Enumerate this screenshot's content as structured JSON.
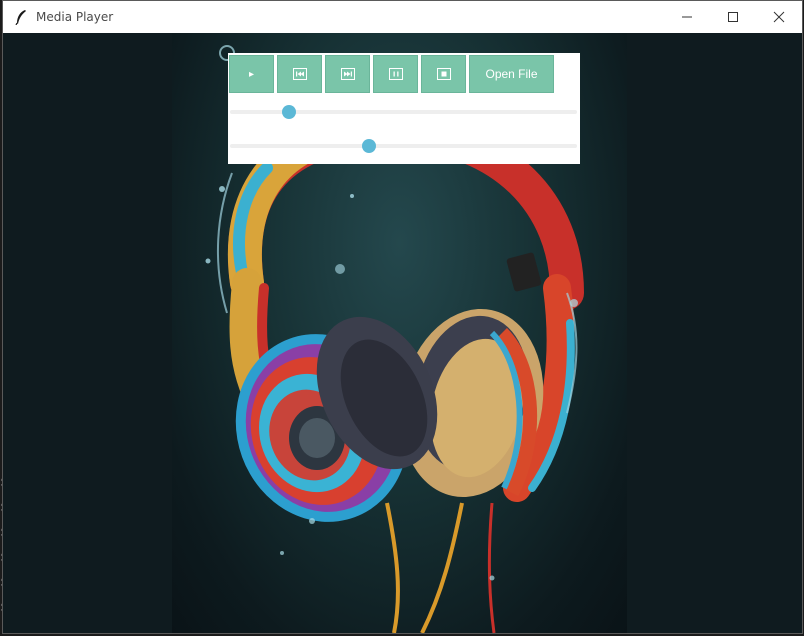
{
  "window": {
    "title": "Media Player"
  },
  "controls": {
    "play_label": "▸",
    "prev_label": "⏮",
    "next_label": "⏭",
    "pause_label": "⏸",
    "stop_label": "⏹",
    "open_file_label": "Open File"
  },
  "sliders": {
    "progress_fraction": 0.17,
    "volume_fraction": 0.4
  },
  "colors": {
    "button_bg": "#7ac5a9",
    "knob": "#5bb8d6",
    "panel_bg": "#ffffff"
  }
}
